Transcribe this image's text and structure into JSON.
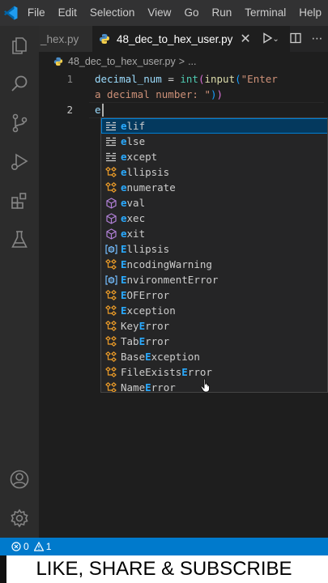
{
  "menubar": {
    "logo_icon": "vscode-logo-icon",
    "items": [
      "File",
      "Edit",
      "Selection",
      "View",
      "Go",
      "Run",
      "Terminal",
      "Help"
    ]
  },
  "activitybar": {
    "items": [
      {
        "icon": "explorer-icon"
      },
      {
        "icon": "search-icon"
      },
      {
        "icon": "source-control-icon"
      },
      {
        "icon": "run-debug-icon"
      },
      {
        "icon": "extensions-icon"
      },
      {
        "icon": "testing-icon"
      }
    ],
    "bottom": [
      {
        "icon": "account-icon"
      },
      {
        "icon": "settings-gear-icon"
      }
    ]
  },
  "tabs": {
    "inactive_label": "_hex.py",
    "active_label": "48_dec_to_hex_user.py"
  },
  "breadcrumb": {
    "file": "48_dec_to_hex_user.py",
    "separator": ">",
    "ellipsis": "..."
  },
  "editor": {
    "lines": [
      {
        "num": "1",
        "text": "decimal_num = int(input(\"Enter"
      },
      {
        "num": "",
        "text": "a decimal number: \"))"
      },
      {
        "num": "2",
        "text": "e"
      }
    ]
  },
  "suggestions": [
    {
      "kind": "keyword",
      "match": "e",
      "rest": "lif",
      "selected": true
    },
    {
      "kind": "keyword",
      "match": "e",
      "rest": "lse"
    },
    {
      "kind": "keyword",
      "match": "e",
      "rest": "xcept"
    },
    {
      "kind": "class",
      "match": "e",
      "rest": "llipsis"
    },
    {
      "kind": "class",
      "match": "e",
      "rest": "numerate"
    },
    {
      "kind": "function",
      "match": "e",
      "rest": "val"
    },
    {
      "kind": "function",
      "match": "e",
      "rest": "xec"
    },
    {
      "kind": "function",
      "match": "e",
      "rest": "xit"
    },
    {
      "kind": "variable",
      "match": "E",
      "rest": "llipsis"
    },
    {
      "kind": "class",
      "match": "E",
      "rest": "ncodingWarning"
    },
    {
      "kind": "variable",
      "match": "E",
      "rest": "nvironmentError"
    },
    {
      "kind": "class",
      "match": "E",
      "rest": "OFError"
    },
    {
      "kind": "class",
      "match": "E",
      "rest": "xception"
    },
    {
      "kind": "class",
      "pre": "Key",
      "match": "E",
      "rest": "rror"
    },
    {
      "kind": "class",
      "pre": "Tab",
      "match": "E",
      "rest": "rror"
    },
    {
      "kind": "class",
      "pre": "Base",
      "match": "E",
      "rest": "xception"
    },
    {
      "kind": "class",
      "pre": "FileExists",
      "match": "E",
      "rest": "rror"
    },
    {
      "kind": "class",
      "pre": "Name",
      "match": "E",
      "rest": "rror"
    }
  ],
  "statusbar": {
    "errors": "0",
    "warnings": "1"
  },
  "banner": {
    "text": "LIKE, SHARE & SUBSCRIBE"
  },
  "colors": {
    "accent": "#007acc",
    "match": "#2aaaff",
    "keyword": "#c586c0",
    "function": "#dcdcaa",
    "string": "#ce9178",
    "variable": "#9cdcfe",
    "class_icon": "#ee9d28",
    "func_icon": "#b180d7",
    "var_icon": "#75beff",
    "python": "#4a8cc7"
  }
}
